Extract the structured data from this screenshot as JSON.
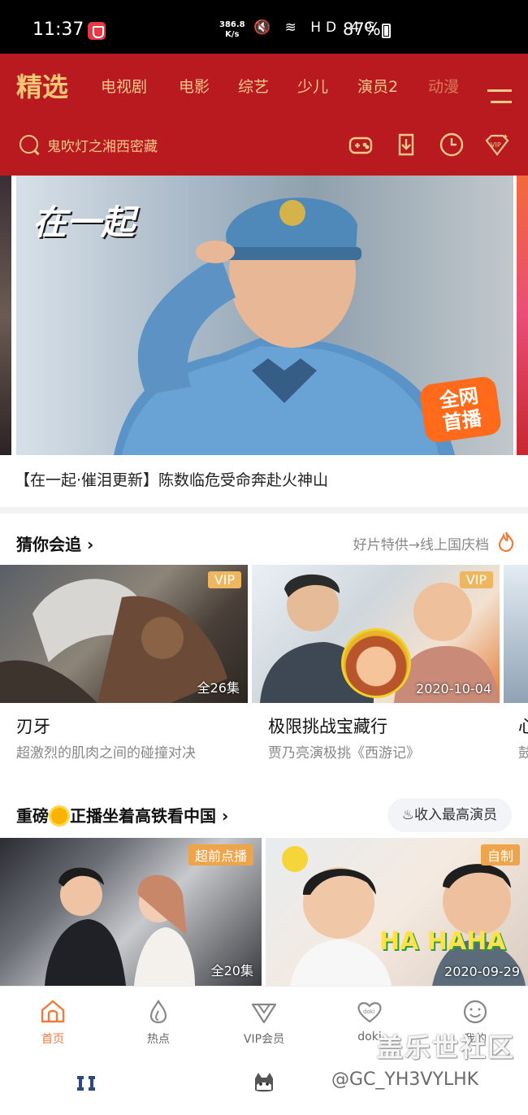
{
  "status": {
    "time": "11:37",
    "speed": "386.8\nK/s",
    "icons": "🔇 ≋ HD 4G",
    "battery": "87%"
  },
  "header": {
    "tabs": [
      "精选",
      "电视剧",
      "电影",
      "综艺",
      "少儿",
      "演员2",
      "动漫"
    ],
    "search_placeholder": "鬼吹灯之湘西密藏",
    "icons": [
      "gamepad-icon",
      "download-icon",
      "history-icon",
      "vip-icon"
    ],
    "accent": "#b81a1f"
  },
  "banner": {
    "art_title": "在一起",
    "live_badge": "全网\n首播",
    "headline": "【在一起·催泪更新】陈数临危受命奔赴火神山"
  },
  "section1": {
    "title": "猜你会追",
    "chevron": "›",
    "right_text": "好片特供→线上国庆档",
    "cards": [
      {
        "badge": "VIP",
        "foot": "全26集",
        "title": "刃牙",
        "subtitle": "超激烈的肌肉之间的碰撞对决"
      },
      {
        "badge": "VIP",
        "foot": "2020-10-04",
        "title": "极限挑战宝藏行",
        "subtitle": "贾乃亮演极挑《西游记》"
      },
      {
        "title": "心",
        "subtitle": "鼓"
      }
    ]
  },
  "section2": {
    "title_a": "重磅",
    "title_b": "正播坐着高铁看中国",
    "chevron": "›",
    "pill": "♨收入最高演员",
    "cards": [
      {
        "badge": "超前点播",
        "foot": "全20集"
      },
      {
        "badge": "自制",
        "foot": "2020-09-29",
        "art_text": "HA HAHA"
      }
    ]
  },
  "nav": {
    "items": [
      {
        "label": "首页",
        "icon": "home-icon"
      },
      {
        "label": "热点",
        "icon": "drop-icon"
      },
      {
        "label": "VIP会员",
        "icon": "vip-diamond-icon"
      },
      {
        "label": "doki",
        "icon": "doki-heart-icon"
      },
      {
        "label": "我的",
        "icon": "smile-icon"
      }
    ]
  },
  "watermark": {
    "line1": "盖乐世社区",
    "line2": "@GC_YH3VYLHK"
  }
}
